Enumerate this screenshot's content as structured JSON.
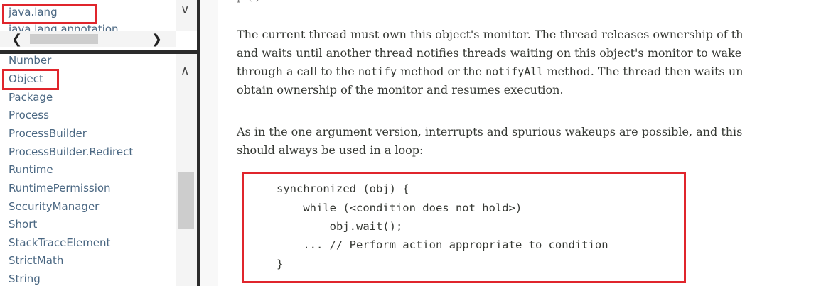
{
  "packages": {
    "items": [
      "java.lang",
      "java.lang.annotation"
    ],
    "selected": "java.lang"
  },
  "classes": {
    "items": [
      "Number",
      "Object",
      "Package",
      "Process",
      "ProcessBuilder",
      "ProcessBuilder.Redirect",
      "Runtime",
      "RuntimePermission",
      "SecurityManager",
      "Short",
      "StackTraceElement",
      "StrictMath",
      "String"
    ],
    "selected": "Object"
  },
  "content": {
    "cut_top_line": "p                    (   )",
    "para1": {
      "line1_a": "The current thread must own this object's monitor. The thread releases ownership of th",
      "line2_a": "and waits until another thread notifies threads waiting on this object's monitor to wake",
      "line3_a": "through a call to the ",
      "line3_code1": "notify",
      "line3_b": " method or the ",
      "line3_code2": "notifyAll",
      "line3_c": " method. The thread then waits un",
      "line4_a": "obtain ownership of the monitor and resumes execution."
    },
    "para2": {
      "line1": "As in the one argument version, interrupts and spurious wakeups are possible, and this",
      "line2": "should always be used in a loop:"
    },
    "code": [
      "synchronized (obj) {",
      "    while (<condition does not hold>)",
      "        obj.wait();",
      "    ... // Perform action appropriate to condition",
      "}"
    ]
  },
  "colors": {
    "link": "#4a6782",
    "highlight_box": "#e0252c",
    "text": "#353833"
  },
  "icons": [
    "chevron-down-icon",
    "chevron-up-icon",
    "chevron-left-icon",
    "chevron-right-icon"
  ]
}
